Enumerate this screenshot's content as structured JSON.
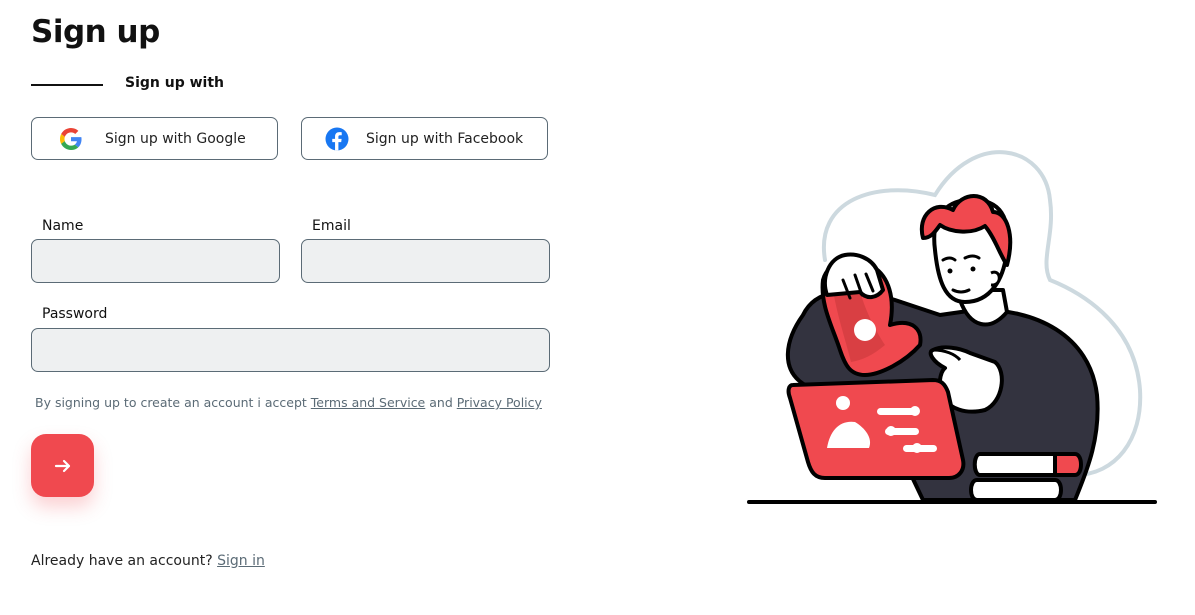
{
  "page": {
    "title": "Sign up"
  },
  "social": {
    "divider_label": "Sign up with",
    "google_label": "Sign up with Google",
    "facebook_label": "Sign up with Facebook"
  },
  "form": {
    "name_label": "Name",
    "email_label": "Email",
    "password_label": "Password",
    "name_value": "",
    "email_value": "",
    "password_value": "",
    "terms_prefix": "By signing up to create an account i accept ",
    "terms_link": "Terms and Service",
    "terms_and": " and ",
    "privacy_link": "Privacy Policy",
    "submit_icon": "arrow-right-icon"
  },
  "footer": {
    "prompt": "Already have an account? ",
    "signin_link": "Sign in"
  },
  "colors": {
    "accent": "#f0494f",
    "field_bg": "#eef0f1",
    "border": "#5b6b76",
    "illustration_dark": "#33333f",
    "illustration_outline": "#cdd9df"
  },
  "illustration": {
    "name": "person-with-laptop-illustration"
  }
}
